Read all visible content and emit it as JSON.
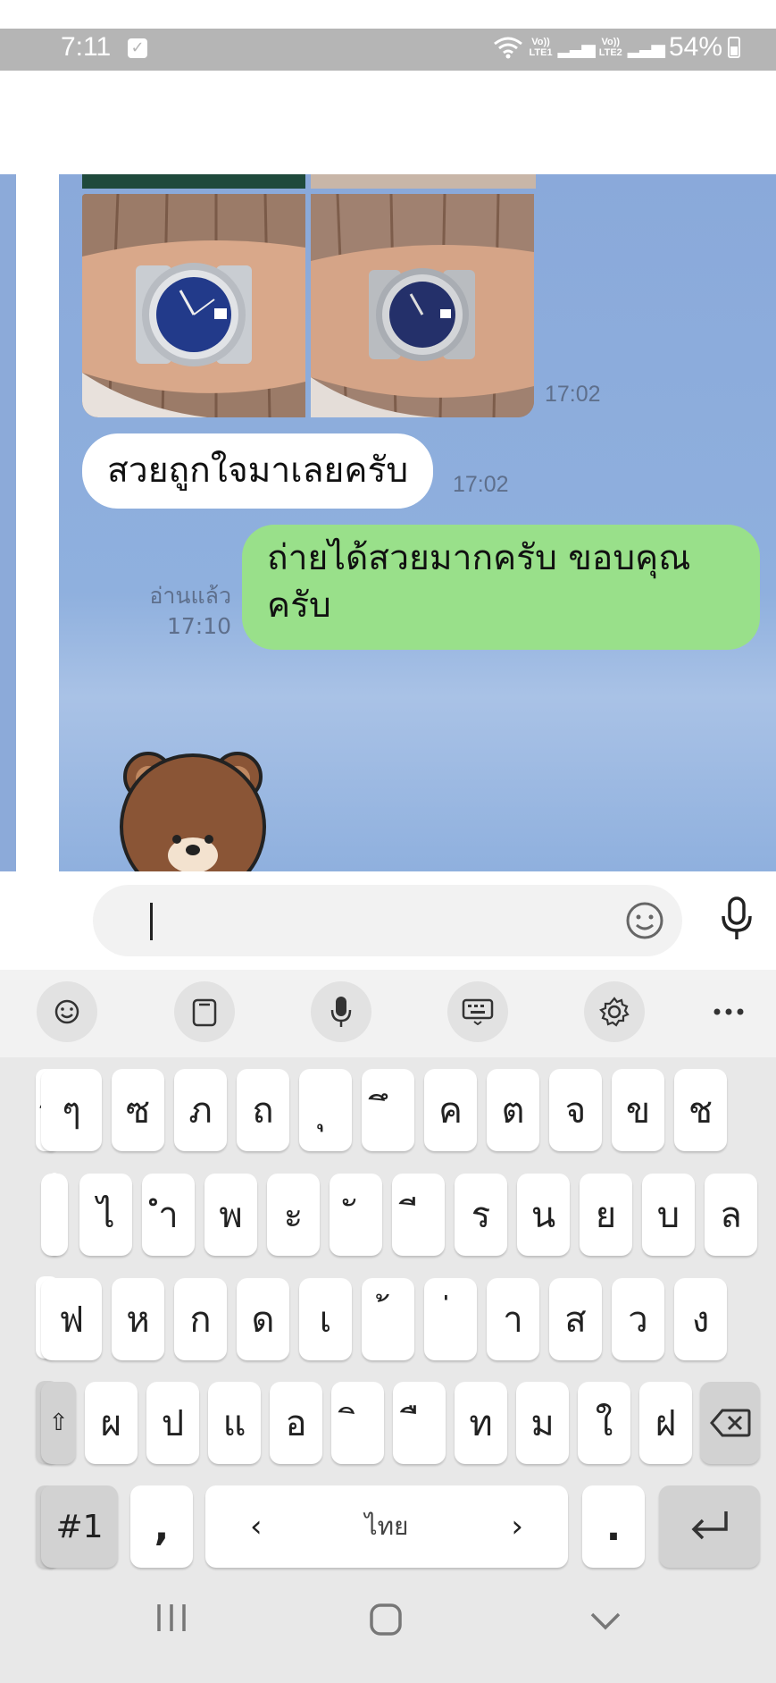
{
  "status_bar": {
    "time": "7:11",
    "network1": "Vo)) LTE1",
    "network2": "Vo)) LTE2",
    "battery": "54%"
  },
  "chat": {
    "photo_timestamp": "17:02",
    "incoming_message": "สวยถูกใจมาเลยครับ",
    "incoming_timestamp": "17:02",
    "outgoing_message": "ถ่ายได้สวยมากครับ ขอบคุณครับ",
    "read_label": "อ่านแล้ว",
    "outgoing_timestamp": "17:10"
  },
  "input": {
    "placeholder": ""
  },
  "keyboard": {
    "row1": [
      "ๆ",
      "ซ",
      "ภ",
      "ถ",
      "ุ",
      "ึ",
      "ค",
      "ต",
      "จ",
      "ข",
      "ช"
    ],
    "row2": [
      "ไ",
      "ำ",
      "พ",
      "ะ",
      "ั",
      "ี",
      "ร",
      "น",
      "ย",
      "บ",
      "ล"
    ],
    "row3": [
      "ฟ",
      "ห",
      "ก",
      "ด",
      "เ",
      "้",
      "่",
      "า",
      "ส",
      "ว",
      "ง"
    ],
    "row4": [
      "ผ",
      "ป",
      "แ",
      "อ",
      "ิ",
      "ื",
      "ท",
      "ม",
      "ใ",
      "ฝ"
    ],
    "left_edge_row1": "ๅ",
    "left_edge_row3": "ฟ",
    "symbols_key": "#1",
    "comma_key": ",",
    "space_label": "ไทย",
    "period_key": ".",
    "space_left_arrow": "‹",
    "space_right_arrow": "›"
  },
  "colors": {
    "chat_background": "#8caad9",
    "outgoing_bubble": "#99e08a",
    "incoming_bubble": "#ffffff",
    "status_bar": "#b5b5b5"
  }
}
